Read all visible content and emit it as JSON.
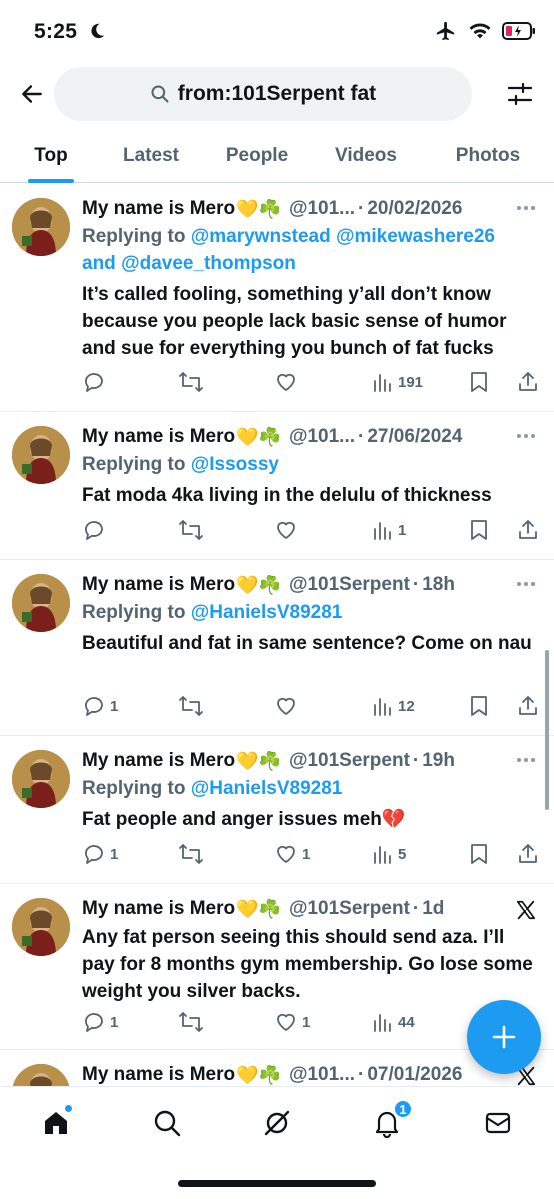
{
  "status_bar": {
    "time": "5:25"
  },
  "header": {
    "search_query": "from:101Serpent fat"
  },
  "tabs": [
    {
      "label": "Top",
      "active": true
    },
    {
      "label": "Latest",
      "active": false
    },
    {
      "label": "People",
      "active": false
    },
    {
      "label": "Videos",
      "active": false
    },
    {
      "label": "Photos",
      "active": false
    }
  ],
  "tweets": [
    {
      "name": "My name is Mero",
      "emoji": "💛☘️",
      "handle": "@101...",
      "time": "20/02/2026",
      "reply_prefix": "Replying to",
      "mention1": "@marywnstead",
      "mention2": "@mikewashere26",
      "mention_and": "and",
      "mention3": "@davee_thompson",
      "text": "It’s called fooling, something y’all don’t know because you people lack basic sense of humor and sue for everything you bunch of fat fucks",
      "replies": "",
      "retweets": "",
      "likes": "",
      "views": "191"
    },
    {
      "name": "My name is Mero",
      "emoji": "💛☘️",
      "handle": "@101...",
      "time": "27/06/2024",
      "reply_prefix": "Replying to",
      "mention1": "@Issossy",
      "text": "Fat moda 4ka living in the delulu of thickness",
      "replies": "",
      "retweets": "",
      "likes": "",
      "views": "1"
    },
    {
      "name": "My name is Mero",
      "emoji": "💛☘️",
      "handle": "@101Serpent",
      "time": "18h",
      "reply_prefix": "Replying to",
      "mention1": "@HanielsV89281",
      "text": "Beautiful and fat in same sentence? Come on nau",
      "replies": "1",
      "retweets": "",
      "likes": "",
      "views": "12"
    },
    {
      "name": "My name is Mero",
      "emoji": "💛☘️",
      "handle": "@101Serpent",
      "time": "19h",
      "reply_prefix": "Replying to",
      "mention1": "@HanielsV89281",
      "text": "Fat people and anger issues meh💔",
      "replies": "1",
      "retweets": "",
      "likes": "1",
      "views": "5"
    },
    {
      "name": "My name is Mero",
      "emoji": "💛☘️",
      "handle": "@101Serpent",
      "time": "1d",
      "text": "Any fat person seeing this should send aza. I’ll pay for 8 months gym membership. Go lose some weight you silver backs.",
      "replies": "1",
      "retweets": "",
      "likes": "1",
      "views": "44"
    },
    {
      "name": "My name is Mero",
      "emoji": "💛☘️",
      "handle": "@101...",
      "time": "07/01/2026"
    }
  ],
  "nav": {
    "notifications_badge": "1"
  },
  "icons": {
    "back": "arrow-left-icon",
    "search": "search-icon",
    "filter": "sliders-icon",
    "more": "more-dots-icon",
    "reply": "reply-icon",
    "retweet": "retweet-icon",
    "like": "heart-icon",
    "views": "views-icon",
    "bookmark": "bookmark-icon",
    "share": "share-icon",
    "compose": "plus-icon",
    "x": "x-logo-icon",
    "home": "home-icon",
    "explore": "search-icon",
    "grok": "grok-icon",
    "notifications": "bell-icon",
    "messages": "mail-icon"
  },
  "colors": {
    "accent": "#1d9bf0",
    "text": "#0f1419",
    "secondary": "#536471"
  }
}
